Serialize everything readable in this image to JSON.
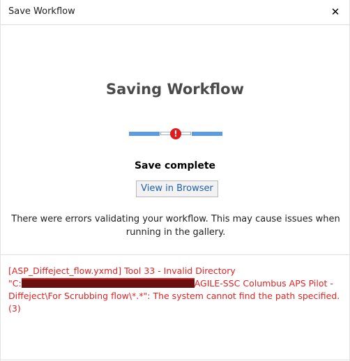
{
  "window": {
    "title": "Save Workflow",
    "close_glyph": "✕"
  },
  "main": {
    "heading": "Saving Workflow",
    "progress_error_glyph": "!",
    "status": "Save complete",
    "view_button_label": "View in Browser",
    "message": "There were errors validating your workflow. This may cause issues when running in the gallery."
  },
  "error": {
    "line1": "[ASP_Diffeject_flow.yxmd] Tool 33 - Invalid Directory",
    "prefix": "\"C:",
    "suffix": "AGILE-SSC Columbus APS Pilot - Diffeject\\For Scrubbing flow\\*.*\": The system cannot find the path specified. (3)"
  },
  "colors": {
    "accent": "#5b9ae6",
    "error": "#e02424",
    "link": "#1f5fae"
  },
  "icons": {
    "close": "close-icon",
    "progress_error": "error-icon"
  }
}
